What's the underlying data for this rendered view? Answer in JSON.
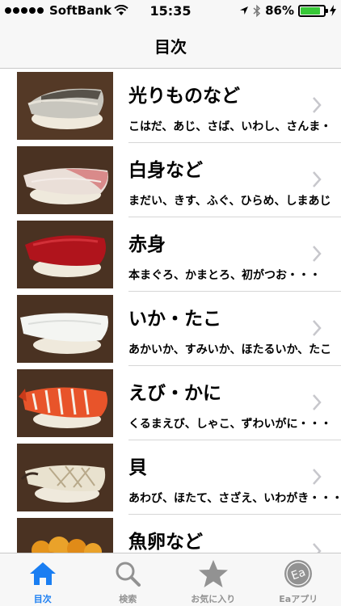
{
  "status_bar": {
    "carrier": "SoftBank",
    "time": "15:35",
    "battery": "86%",
    "battery_level": 0.86,
    "battery_color": "#37c837"
  },
  "nav": {
    "title": "目次"
  },
  "list": [
    {
      "title": "光りものなど",
      "subtitle": "こはだ、あじ、さば、いわし、さんま・",
      "icon": "shiny-fish-sushi"
    },
    {
      "title": "白身など",
      "subtitle": "まだい、きす、ふぐ、ひらめ、しまあじ",
      "icon": "white-fish-sushi"
    },
    {
      "title": "赤身",
      "subtitle": "本まぐろ、かまとろ、初がつお・・・",
      "icon": "tuna-sushi"
    },
    {
      "title": "いか・たこ",
      "subtitle": "あかいか、すみいか、ほたるいか、たこ",
      "icon": "squid-sushi"
    },
    {
      "title": "えび・かに",
      "subtitle": "くるまえび、しゃこ、ずわいがに・・・",
      "icon": "shrimp-sushi"
    },
    {
      "title": "貝",
      "subtitle": "あわび、ほたて、さざえ、いわがき・・・",
      "icon": "shellfish-sushi"
    },
    {
      "title": "魚卵など",
      "subtitle": "",
      "icon": "fish-roe-sushi"
    }
  ],
  "tabs": [
    {
      "label": "目次",
      "icon": "home-icon",
      "active": true
    },
    {
      "label": "検索",
      "icon": "search-icon",
      "active": false
    },
    {
      "label": "お気に入り",
      "icon": "star-icon",
      "active": false
    },
    {
      "label": "Eaアプリ",
      "icon": "ea-app-icon",
      "active": false
    }
  ],
  "colors": {
    "accent": "#1a7ef2",
    "inactive": "#929292"
  }
}
